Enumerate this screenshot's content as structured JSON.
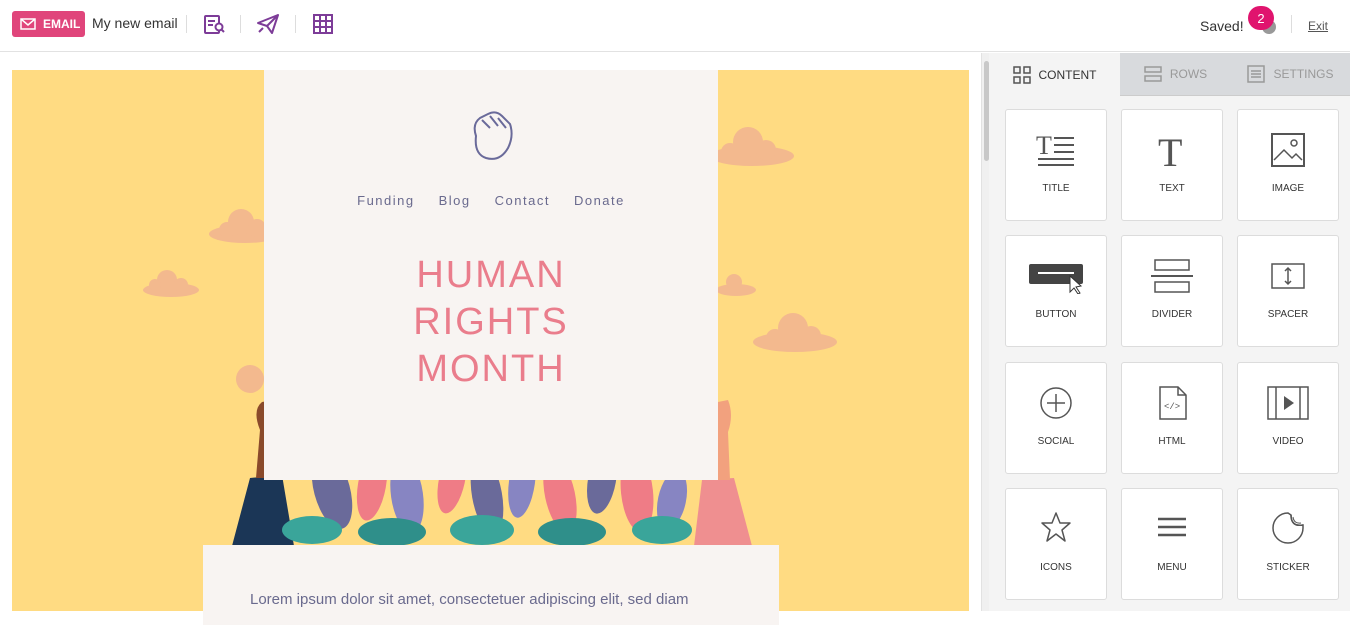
{
  "topbar": {
    "email_badge": "EMAIL",
    "email_name": "My new email",
    "saved_label": "Saved!",
    "notifications_count": "2",
    "exit_label": "Exit"
  },
  "preview": {
    "nav": [
      "Funding",
      "Blog",
      "Contact",
      "Donate"
    ],
    "headline": [
      "HUMAN",
      "RIGHTS",
      "MONTH"
    ],
    "body_text": "Lorem ipsum dolor sit amet, consectetuer adipiscing elit, sed diam"
  },
  "panel": {
    "tabs": [
      {
        "label": "CONTENT",
        "icon": "grid-icon"
      },
      {
        "label": "ROWS",
        "icon": "rows-icon"
      },
      {
        "label": "SETTINGS",
        "icon": "settings-icon"
      }
    ],
    "blocks": [
      {
        "label": "TITLE",
        "icon": "title-icon"
      },
      {
        "label": "TEXT",
        "icon": "text-icon"
      },
      {
        "label": "IMAGE",
        "icon": "image-icon"
      },
      {
        "label": "BUTTON",
        "icon": "button-icon"
      },
      {
        "label": "DIVIDER",
        "icon": "divider-icon"
      },
      {
        "label": "SPACER",
        "icon": "spacer-icon"
      },
      {
        "label": "SOCIAL",
        "icon": "social-icon"
      },
      {
        "label": "HTML",
        "icon": "html-icon"
      },
      {
        "label": "VIDEO",
        "icon": "video-icon"
      },
      {
        "label": "ICONS",
        "icon": "star-icon"
      },
      {
        "label": "MENU",
        "icon": "menu-icon"
      },
      {
        "label": "STICKER",
        "icon": "sticker-icon"
      }
    ]
  },
  "colors": {
    "accent": "#e0457b",
    "canvas_bg": "#ffdb82",
    "headline": "#ea7d8c",
    "nav_text": "#6a6a8e",
    "toolbar_icons": "#7d3c98"
  }
}
